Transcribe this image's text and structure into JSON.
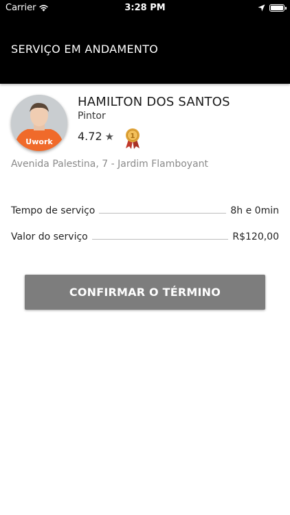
{
  "status_bar": {
    "carrier": "Carrier",
    "time": "3:28 PM"
  },
  "header": {
    "title": "SERVIÇO EM ANDAMENTO"
  },
  "provider": {
    "name": "HAMILTON DOS SANTOS",
    "role": "Pintor",
    "rating": "4.72",
    "shirt_text": "Uwork",
    "address": "Avenida Palestina, 7 - Jardim Flamboyant"
  },
  "details": [
    {
      "label": "Tempo de serviço",
      "value": "8h e 0min"
    },
    {
      "label": "Valor do serviço",
      "value": "R$120,00"
    }
  ],
  "actions": {
    "confirm_label": "CONFIRMAR O TÉRMINO"
  },
  "colors": {
    "header_bg": "#000000",
    "button_bg": "#7d7d7d",
    "shirt": "#f06a2a",
    "medal": "#e0a43a",
    "ribbon": "#c0392b"
  }
}
